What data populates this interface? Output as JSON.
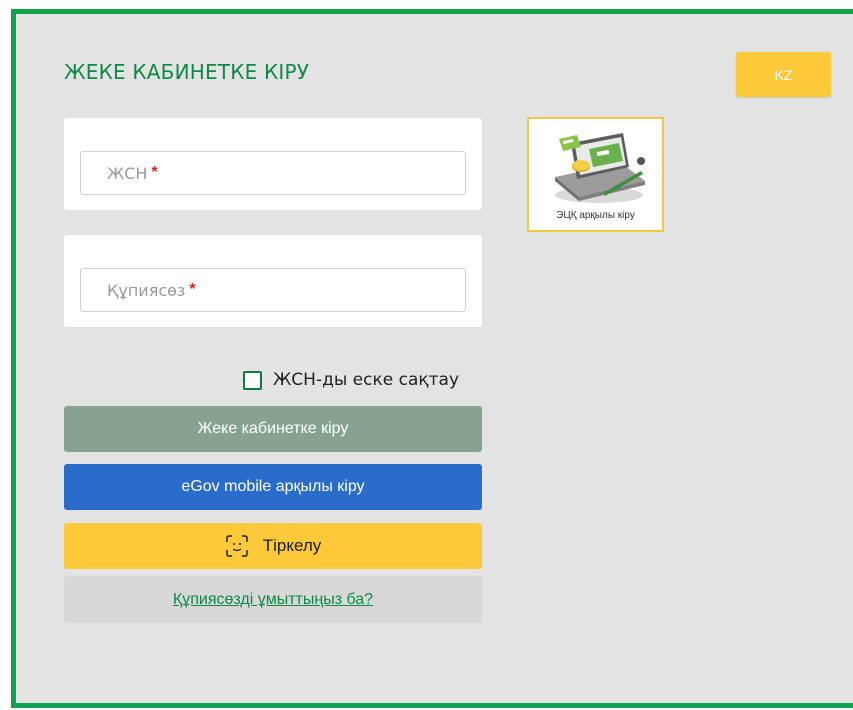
{
  "title": "ЖЕКЕ КАБИНЕТКЕ КІРУ",
  "lang_button": "KZ",
  "iin_field": {
    "placeholder": "ЖСН",
    "required_mark": "*"
  },
  "password_field": {
    "placeholder": "Құпиясөз",
    "required_mark": "*"
  },
  "eds_tile": {
    "label": "ЭЦҚ арқылы кіру",
    "icon": "certificate-card-icon"
  },
  "remember": {
    "label": "ЖСН-ды еске сақтау",
    "checked": false
  },
  "buttons": {
    "login": "Жеке кабинетке кіру",
    "egov": "eGov mobile арқылы кіру",
    "register": "Тіркелу",
    "register_icon": "face-scan-icon",
    "forgot": "Құпиясөзді ұмыттыңыз ба?"
  },
  "colors": {
    "accent_green": "#0d8a45",
    "border_green": "#0fa14c",
    "yellow": "#fbc93a",
    "login_btn": "#86a391",
    "egov_btn": "#2a6ccc",
    "panel_bg": "#e3e3e3"
  }
}
